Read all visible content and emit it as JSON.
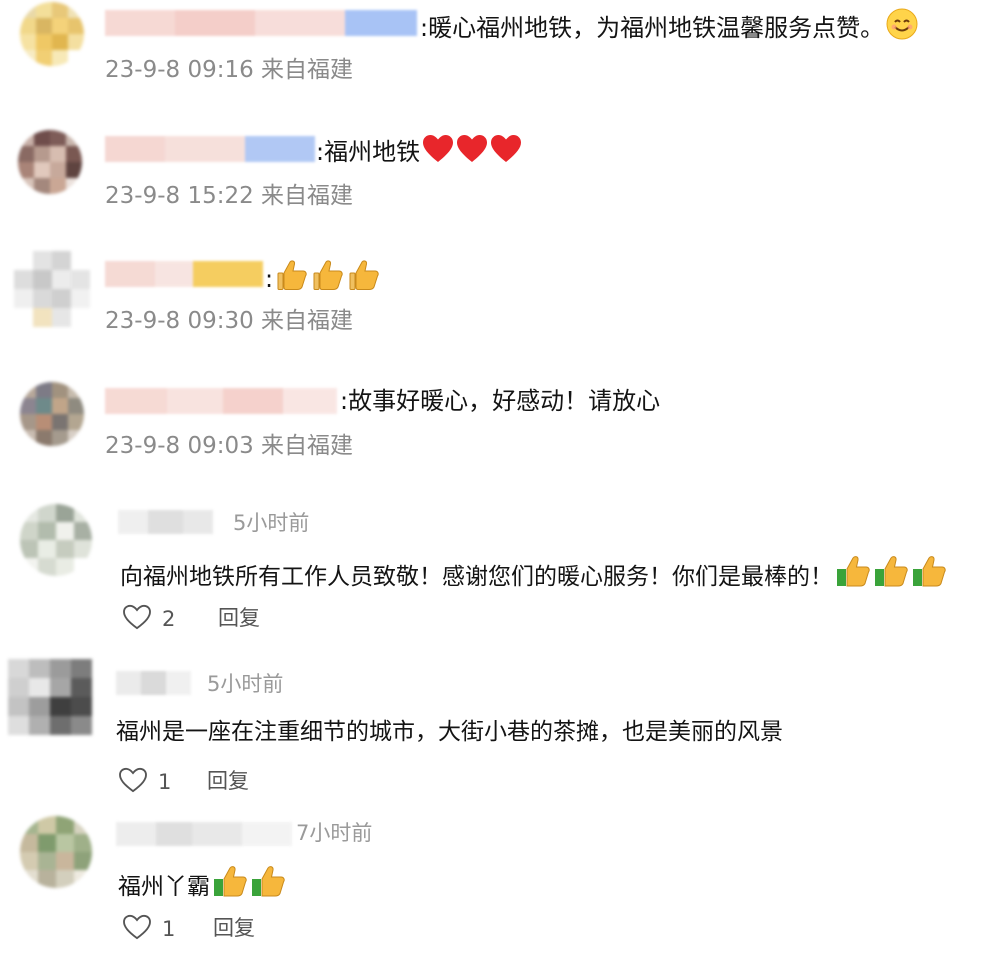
{
  "weibo_comments": [
    {
      "separator": ":",
      "text": "暖心福州地铁，为福州地铁温馨服务点赞。",
      "emojis": [
        "smile-emoji"
      ],
      "meta": "23-9-8 09:16 来自福建"
    },
    {
      "separator": ":",
      "text": "福州地铁",
      "emojis": [
        "heart-emoji",
        "heart-emoji",
        "heart-emoji"
      ],
      "meta": "23-9-8 15:22 来自福建"
    },
    {
      "separator": ":",
      "text": "",
      "emojis": [
        "thumbs-up-emoji",
        "thumbs-up-emoji",
        "thumbs-up-emoji"
      ],
      "meta": "23-9-8 09:30 来自福建"
    },
    {
      "separator": ":",
      "text": "故事好暖心，好感动！请放心",
      "emojis": [],
      "meta": "23-9-8 09:03 来自福建"
    }
  ],
  "app_comments": [
    {
      "time": "5小时前",
      "text": "向福州地铁所有工作人员致敬！感谢您们的暖心服务！你们是最棒的！",
      "emojis": [
        "thumbs-up-emoji",
        "thumbs-up-emoji",
        "thumbs-up-emoji"
      ],
      "likes": "2",
      "reply_label": "回复"
    },
    {
      "time": "5小时前",
      "text": "福州是一座在注重细节的城市，大街小巷的茶摊，也是美丽的风景",
      "emojis": [],
      "likes": "1",
      "reply_label": "回复"
    },
    {
      "time": "7小时前",
      "text": "福州丫霸",
      "emojis": [
        "thumbs-up-emoji",
        "thumbs-up-emoji"
      ],
      "likes": "1",
      "reply_label": "回复"
    }
  ],
  "colors": {
    "meta_gray": "#8a8a8a",
    "heart_red": "#e8262b",
    "thumb_yellow": "#f6b73c",
    "sleeve_green": "#3aa33a"
  }
}
